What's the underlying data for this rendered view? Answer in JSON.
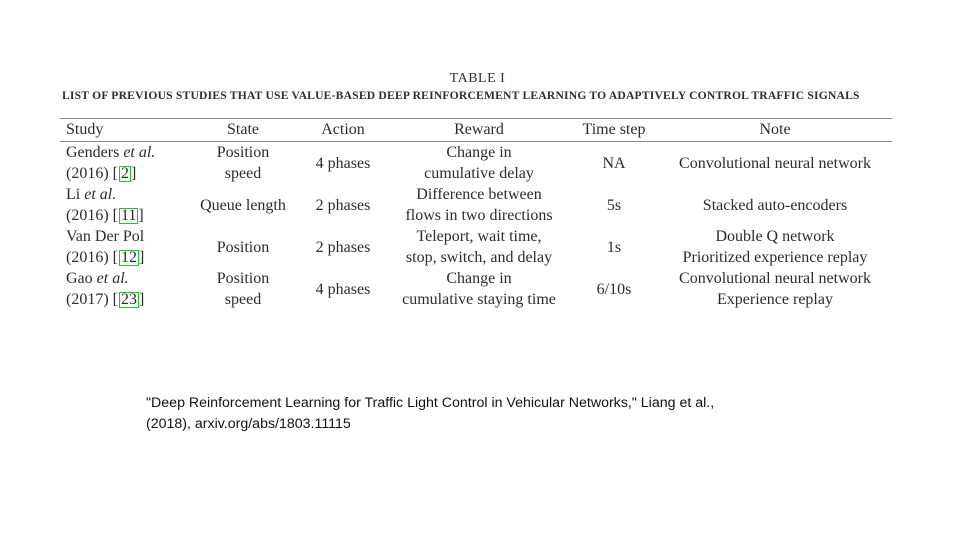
{
  "table": {
    "label": "TABLE I",
    "title": "LIST OF PREVIOUS STUDIES THAT USE VALUE-BASED DEEP REINFORCEMENT LEARNING TO ADAPTIVELY CONTROL TRAFFIC SIGNALS",
    "headers": [
      "Study",
      "State",
      "Action",
      "Reward",
      "Time step",
      "Note"
    ],
    "cite_color": "#22c232",
    "rows": [
      {
        "study_author": "Genders",
        "study_etal": "et al.",
        "study_year": "(2016)",
        "study_ref": "2",
        "state": [
          "Position",
          "speed"
        ],
        "action": "4 phases",
        "reward": [
          "Change in",
          "cumulative delay"
        ],
        "time_step": "NA",
        "note": [
          "Convolutional neural network"
        ]
      },
      {
        "study_author": "Li",
        "study_etal": "et al.",
        "study_year": "(2016)",
        "study_ref": "11",
        "state": [
          "Queue length"
        ],
        "action": "2 phases",
        "reward": [
          "Difference between",
          "flows in two directions"
        ],
        "time_step": "5s",
        "note": [
          "Stacked auto-encoders"
        ]
      },
      {
        "study_author": "Van Der Pol",
        "study_etal": "",
        "study_year": "(2016)",
        "study_ref": "12",
        "state": [
          "Position"
        ],
        "action": "2 phases",
        "reward": [
          "Teleport, wait time,",
          "stop, switch, and delay"
        ],
        "time_step": "1s",
        "note": [
          "Double Q network",
          "Prioritized experience replay"
        ]
      },
      {
        "study_author": "Gao",
        "study_etal": "et al.",
        "study_year": "(2017)",
        "study_ref": "23",
        "state": [
          "Position",
          "speed"
        ],
        "action": "4 phases",
        "reward": [
          "Change in",
          "cumulative staying time"
        ],
        "time_step": "6/10s",
        "note": [
          "Convolutional neural network",
          "Experience replay"
        ]
      }
    ]
  },
  "citation": {
    "line1": "\"Deep Reinforcement Learning for Traffic Light Control in Vehicular Networks,\" Liang et al.,",
    "line2": "(2018), arxiv.org/abs/1803.11115"
  }
}
